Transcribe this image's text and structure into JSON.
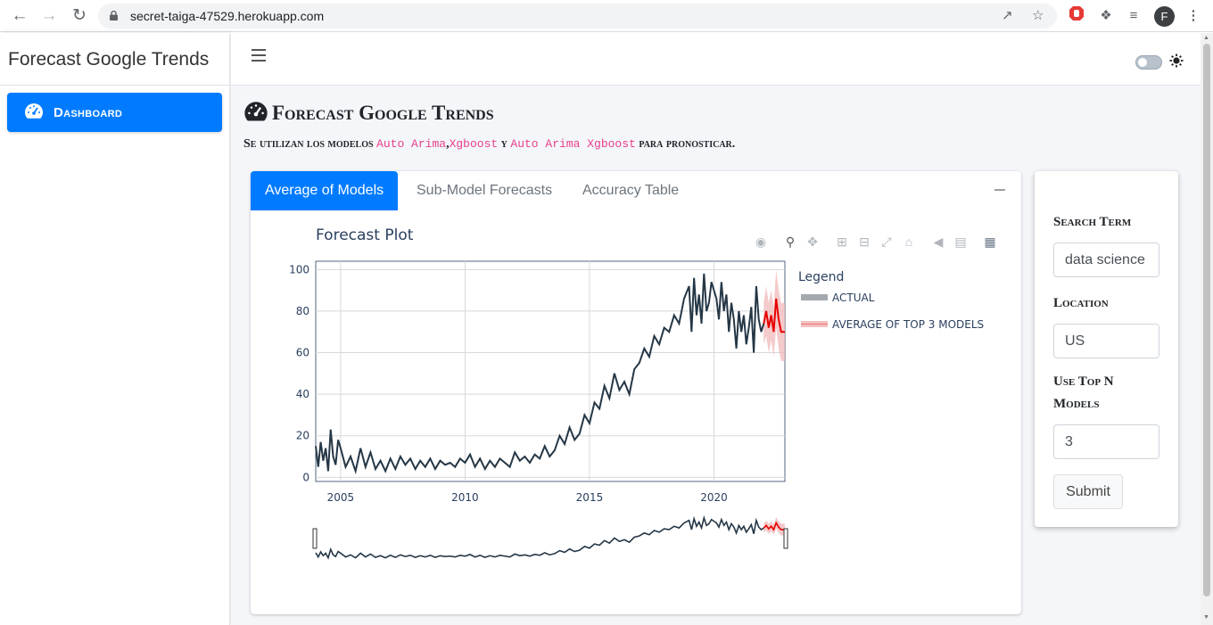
{
  "browser": {
    "url": "secret-taiga-47529.herokuapp.com",
    "profile_initial": "F"
  },
  "sidebar": {
    "brand": "Forecast Google Trends",
    "items": [
      {
        "label": "Dashboard",
        "icon": "tachometer-icon",
        "active": true
      }
    ]
  },
  "header": {
    "title": "Forecast Google Trends",
    "subtitle_prefix": "Se utilizan los modelos",
    "models": [
      "Auto Arima",
      "Xgboost",
      "Auto Arima Xgboost"
    ],
    "sep1": ",",
    "sep2": "y",
    "subtitle_suffix": "para pronosticar."
  },
  "tabs": [
    {
      "label": "Average of Models",
      "active": true
    },
    {
      "label": "Sub-Model Forecasts",
      "active": false
    },
    {
      "label": "Accuracy Table",
      "active": false
    }
  ],
  "form": {
    "search_label": "Search Term",
    "search_value": "data science",
    "location_label": "Location",
    "location_value": "US",
    "topn_label_1": "Use Top N",
    "topn_label_2": "Models",
    "topn_value": "3",
    "submit_label": "Submit"
  },
  "colors": {
    "accent": "#007bff",
    "actual": "#253746",
    "forecast": "#e60000",
    "band": "#f2b8b8"
  },
  "chart_data": {
    "type": "line",
    "title": "Forecast Plot",
    "legend_title": "Legend",
    "legend_position": "right",
    "grid": true,
    "xlim": [
      2004.0,
      2022.85
    ],
    "ylim": [
      -2,
      104
    ],
    "xticks": [
      "2005",
      "2010",
      "2015",
      "2020"
    ],
    "yticks": [
      "0",
      "20",
      "40",
      "60",
      "80",
      "100"
    ],
    "series": [
      {
        "name": "ACTUAL",
        "x": [
          2004.0,
          2004.1,
          2004.2,
          2004.3,
          2004.4,
          2004.5,
          2004.6,
          2004.7,
          2004.8,
          2004.9,
          2005.0,
          2005.2,
          2005.4,
          2005.6,
          2005.8,
          2006.0,
          2006.2,
          2006.4,
          2006.6,
          2006.8,
          2007.0,
          2007.2,
          2007.4,
          2007.6,
          2007.8,
          2008.0,
          2008.2,
          2008.4,
          2008.6,
          2008.8,
          2009.0,
          2009.2,
          2009.4,
          2009.6,
          2009.8,
          2010.0,
          2010.2,
          2010.4,
          2010.6,
          2010.8,
          2011.0,
          2011.2,
          2011.4,
          2011.6,
          2011.8,
          2012.0,
          2012.2,
          2012.4,
          2012.6,
          2012.8,
          2013.0,
          2013.2,
          2013.4,
          2013.6,
          2013.8,
          2014.0,
          2014.2,
          2014.4,
          2014.6,
          2014.8,
          2015.0,
          2015.2,
          2015.4,
          2015.6,
          2015.8,
          2016.0,
          2016.2,
          2016.4,
          2016.6,
          2016.8,
          2017.0,
          2017.2,
          2017.4,
          2017.6,
          2017.8,
          2018.0,
          2018.2,
          2018.4,
          2018.6,
          2018.8,
          2019.0,
          2019.1,
          2019.2,
          2019.3,
          2019.4,
          2019.5,
          2019.6,
          2019.7,
          2019.8,
          2019.9,
          2020.0,
          2020.1,
          2020.2,
          2020.3,
          2020.4,
          2020.5,
          2020.6,
          2020.7,
          2020.8,
          2020.9,
          2021.0,
          2021.1,
          2021.2,
          2021.3,
          2021.4,
          2021.5,
          2021.6,
          2021.7,
          2021.8,
          2021.9,
          2022.0
        ],
        "y": [
          15,
          5,
          17,
          8,
          14,
          3,
          23,
          10,
          6,
          18,
          14,
          5,
          10,
          3,
          14,
          5,
          12,
          4,
          8,
          3,
          9,
          4,
          10,
          6,
          9,
          4,
          8,
          5,
          9,
          4,
          8,
          6,
          7,
          5,
          9,
          7,
          11,
          5,
          9,
          4,
          8,
          5,
          9,
          7,
          5,
          12,
          8,
          10,
          7,
          11,
          9,
          15,
          10,
          13,
          20,
          16,
          24,
          18,
          21,
          30,
          26,
          36,
          33,
          44,
          38,
          50,
          42,
          46,
          40,
          52,
          55,
          62,
          58,
          68,
          64,
          72,
          70,
          78,
          74,
          86,
          92,
          70,
          96,
          78,
          88,
          74,
          98,
          80,
          84,
          94,
          90,
          86,
          76,
          94,
          80,
          88,
          70,
          84,
          76,
          62,
          80,
          70,
          78,
          64,
          72,
          82,
          60,
          92,
          76,
          70,
          74
        ]
      },
      {
        "name": "AVERAGE OF TOP 3 MODELS",
        "x": [
          2022.0,
          2022.1,
          2022.2,
          2022.3,
          2022.4,
          2022.5,
          2022.6,
          2022.7,
          2022.85
        ],
        "y": [
          74,
          80,
          72,
          78,
          70,
          86,
          76,
          70,
          70
        ],
        "lower": [
          64,
          68,
          60,
          66,
          58,
          72,
          62,
          56,
          56
        ],
        "upper": [
          84,
          92,
          84,
          90,
          82,
          100,
          90,
          84,
          84
        ]
      }
    ]
  }
}
